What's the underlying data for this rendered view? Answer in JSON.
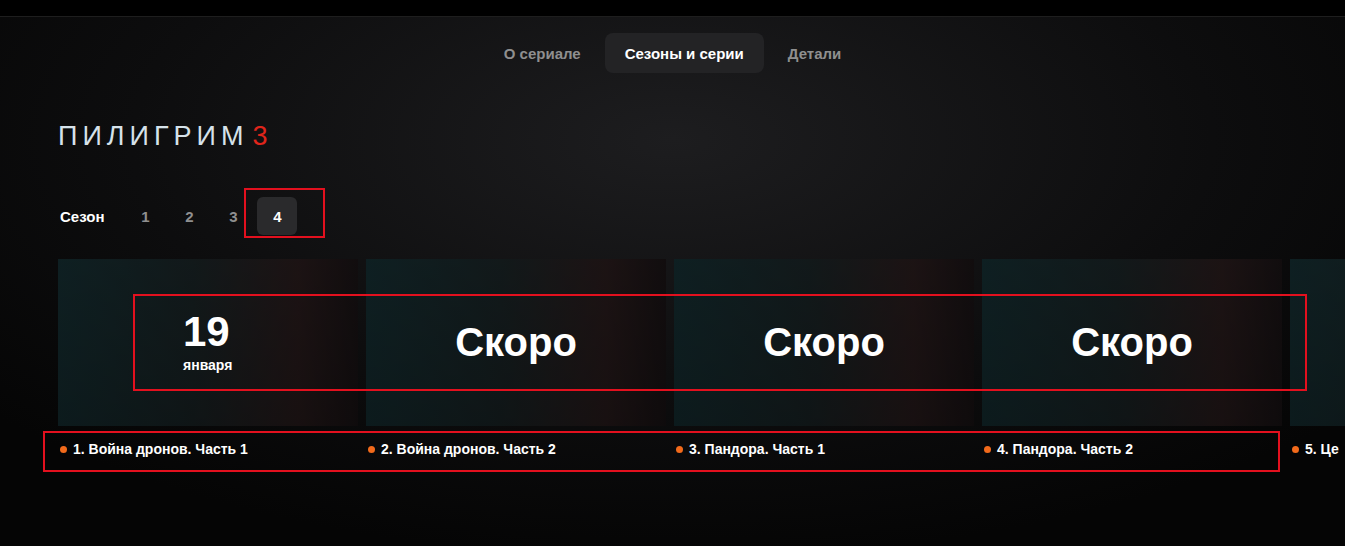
{
  "tabs": [
    {
      "label": "О сериале",
      "selected": false
    },
    {
      "label": "Сезоны и серии",
      "selected": true
    },
    {
      "label": "Детали",
      "selected": false
    }
  ],
  "logo": {
    "title": "ПИЛИГРИМ",
    "number": "3"
  },
  "seasons": {
    "label": "Сезон",
    "items": [
      {
        "label": "1",
        "selected": false
      },
      {
        "label": "2",
        "selected": false
      },
      {
        "label": "3",
        "selected": false
      },
      {
        "label": "4",
        "selected": true
      }
    ]
  },
  "episodes": [
    {
      "title": "1. Война дронов. Часть 1",
      "kind": "dated",
      "day": "19",
      "month": "января"
    },
    {
      "title": "2. Война дронов. Часть 2",
      "kind": "soon",
      "badge": "Скоро"
    },
    {
      "title": "3. Пандора. Часть 1",
      "kind": "soon",
      "badge": "Скоро"
    },
    {
      "title": "4. Пандора. Часть 2",
      "kind": "soon",
      "badge": "Скоро"
    },
    {
      "title": "5. Це",
      "kind": "partial"
    }
  ]
}
